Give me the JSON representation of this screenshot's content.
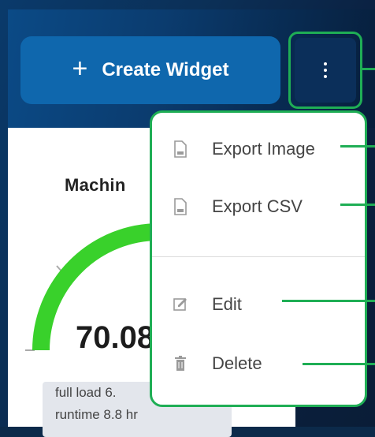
{
  "toolbar": {
    "create_label": "Create Widget",
    "create_icon": "plus-icon",
    "more_icon": "kebab-menu-icon"
  },
  "widget": {
    "title": "Machin",
    "value": "70.08",
    "info_line1": "full load 6.",
    "info_line2": "runtime 8.8 hr",
    "gauge_color": "#39d12b"
  },
  "menu": {
    "items": [
      {
        "label": "Export Image",
        "icon": "image-file-icon"
      },
      {
        "label": "Export CSV",
        "icon": "csv-file-icon"
      },
      {
        "label": "Edit",
        "icon": "edit-icon"
      },
      {
        "label": "Delete",
        "icon": "trash-icon"
      }
    ]
  },
  "colors": {
    "accent": "#1fae55",
    "button": "#0f67ad",
    "background": "#0b2f56"
  }
}
